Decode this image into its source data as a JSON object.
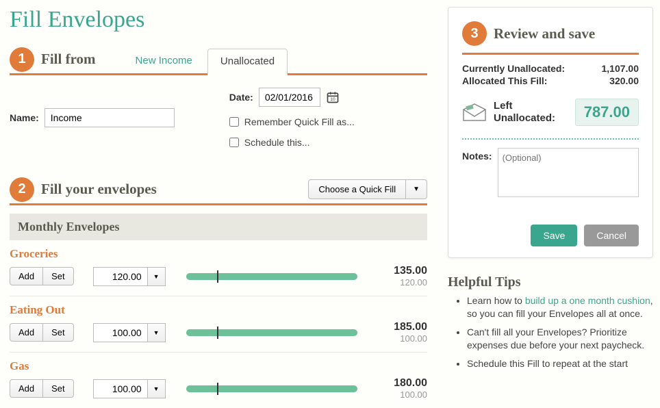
{
  "page_title": "Fill Envelopes",
  "step1": {
    "num": "1",
    "title": "Fill from",
    "tabs": [
      {
        "label": "New Income",
        "active": false
      },
      {
        "label": "Unallocated",
        "active": true
      }
    ],
    "name_label": "Name:",
    "name_value": "Income",
    "date_label": "Date:",
    "date_value": "02/01/2016",
    "remember_label": "Remember Quick Fill as...",
    "schedule_label": "Schedule this..."
  },
  "step2": {
    "num": "2",
    "title": "Fill your envelopes",
    "quickfill_label": "Choose a Quick Fill",
    "section_label": "Monthly Envelopes",
    "add_label": "Add",
    "set_label": "Set",
    "envelopes": [
      {
        "name": "Groceries",
        "amount": "120.00",
        "total": "135.00",
        "sub": "120.00",
        "fill_pct": 100,
        "mark_pct": 18
      },
      {
        "name": "Eating Out",
        "amount": "100.00",
        "total": "185.00",
        "sub": "100.00",
        "fill_pct": 100,
        "mark_pct": 18
      },
      {
        "name": "Gas",
        "amount": "100.00",
        "total": "180.00",
        "sub": "100.00",
        "fill_pct": 100,
        "mark_pct": 18
      }
    ]
  },
  "step3": {
    "num": "3",
    "title": "Review and save",
    "currently_unalloc_label": "Currently Unallocated:",
    "currently_unalloc_val": "1,107.00",
    "allocated_label": "Allocated This Fill:",
    "allocated_val": "320.00",
    "left_label_1": "Left",
    "left_label_2": "Unallocated:",
    "left_val": "787.00",
    "notes_label": "Notes:",
    "notes_placeholder": "(Optional)",
    "save_label": "Save",
    "cancel_label": "Cancel"
  },
  "tips": {
    "title": "Helpful Tips",
    "items": [
      {
        "pre": "Learn how to ",
        "link": "build up a one month cushion",
        "post": ", so you can fill your Envelopes all at once."
      },
      {
        "pre": "Can't fill all your Envelopes? Prioritize expenses due before your next paycheck.",
        "link": "",
        "post": ""
      },
      {
        "pre": "Schedule this Fill to repeat at the start",
        "link": "",
        "post": ""
      }
    ]
  }
}
